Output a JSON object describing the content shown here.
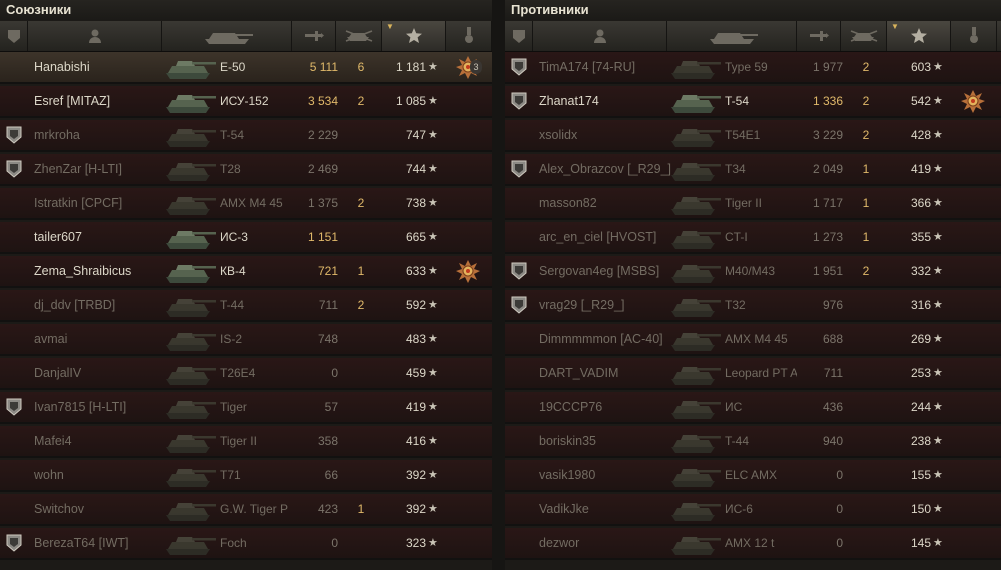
{
  "allies": {
    "title": "Союзники",
    "rows": [
      {
        "badge": false,
        "name": "Hanabishi",
        "tank": "E-50",
        "damage": "5 111",
        "kills": "6",
        "exp": "1 181",
        "medal": "order",
        "medal_count": "3",
        "alive": true,
        "self": true
      },
      {
        "badge": false,
        "name": "Esref [MITAZ]",
        "tank": "ИСУ-152",
        "damage": "3 534",
        "kills": "2",
        "exp": "1 085",
        "medal": "",
        "medal_count": "",
        "alive": true,
        "self": false
      },
      {
        "badge": true,
        "name": "mrkroha",
        "tank": "T-54",
        "damage": "2 229",
        "kills": "",
        "exp": "747",
        "medal": "",
        "medal_count": "",
        "alive": false,
        "self": false
      },
      {
        "badge": true,
        "name": "ZhenZar [H-LTI]",
        "tank": "T28",
        "damage": "2 469",
        "kills": "",
        "exp": "744",
        "medal": "",
        "medal_count": "",
        "alive": false,
        "self": false
      },
      {
        "badge": false,
        "name": "Istratkin [CPCF]",
        "tank": "AMX M4 45",
        "damage": "1 375",
        "kills": "2",
        "exp": "738",
        "medal": "",
        "medal_count": "",
        "alive": false,
        "self": false
      },
      {
        "badge": false,
        "name": "tailer607",
        "tank": "ИС-3",
        "damage": "1 151",
        "kills": "",
        "exp": "665",
        "medal": "",
        "medal_count": "",
        "alive": true,
        "self": false
      },
      {
        "badge": false,
        "name": "Zema_Shraibicus",
        "tank": "КВ-4",
        "damage": "721",
        "kills": "1",
        "exp": "633",
        "medal": "order",
        "medal_count": "",
        "alive": true,
        "self": false
      },
      {
        "badge": false,
        "name": "dj_ddv [TRBD]",
        "tank": "T-44",
        "damage": "711",
        "kills": "2",
        "exp": "592",
        "medal": "",
        "medal_count": "",
        "alive": false,
        "self": false
      },
      {
        "badge": false,
        "name": "avmai",
        "tank": "IS-2",
        "damage": "748",
        "kills": "",
        "exp": "483",
        "medal": "",
        "medal_count": "",
        "alive": false,
        "self": false
      },
      {
        "badge": false,
        "name": "DanjalIV",
        "tank": "T26E4",
        "damage": "0",
        "kills": "",
        "exp": "459",
        "medal": "",
        "medal_count": "",
        "alive": false,
        "self": false
      },
      {
        "badge": true,
        "name": "Ivan7815 [H-LTI]",
        "tank": "Tiger",
        "damage": "57",
        "kills": "",
        "exp": "419",
        "medal": "",
        "medal_count": "",
        "alive": false,
        "self": false
      },
      {
        "badge": false,
        "name": "Mafei4",
        "tank": "Tiger II",
        "damage": "358",
        "kills": "",
        "exp": "416",
        "medal": "",
        "medal_count": "",
        "alive": false,
        "self": false
      },
      {
        "badge": false,
        "name": "wohn",
        "tank": "T71",
        "damage": "66",
        "kills": "",
        "exp": "392",
        "medal": "",
        "medal_count": "",
        "alive": false,
        "self": false
      },
      {
        "badge": false,
        "name": "Switchov",
        "tank": "G.W. Tiger P",
        "damage": "423",
        "kills": "1",
        "exp": "392",
        "medal": "",
        "medal_count": "",
        "alive": false,
        "self": false
      },
      {
        "badge": true,
        "name": "BerezaT64 [IWT]",
        "tank": "Foch",
        "damage": "0",
        "kills": "",
        "exp": "323",
        "medal": "",
        "medal_count": "",
        "alive": false,
        "self": false
      }
    ]
  },
  "enemies": {
    "title": "Противники",
    "rows": [
      {
        "badge": true,
        "name": "TimA174 [74-RU]",
        "tank": "Type 59",
        "damage": "1 977",
        "kills": "2",
        "exp": "603",
        "medal": "",
        "medal_count": "",
        "alive": false,
        "self": false
      },
      {
        "badge": true,
        "name": "Zhanat174",
        "tank": "T-54",
        "damage": "1 336",
        "kills": "2",
        "exp": "542",
        "medal": "order",
        "medal_count": "",
        "alive": true,
        "self": false
      },
      {
        "badge": false,
        "name": "xsolidx",
        "tank": "T54E1",
        "damage": "3 229",
        "kills": "2",
        "exp": "428",
        "medal": "",
        "medal_count": "",
        "alive": false,
        "self": false
      },
      {
        "badge": true,
        "name": "Alex_Obrazcov [_R29_]",
        "tank": "T34",
        "damage": "2 049",
        "kills": "1",
        "exp": "419",
        "medal": "",
        "medal_count": "",
        "alive": false,
        "self": false
      },
      {
        "badge": false,
        "name": "masson82",
        "tank": "Tiger II",
        "damage": "1 717",
        "kills": "1",
        "exp": "366",
        "medal": "",
        "medal_count": "",
        "alive": false,
        "self": false
      },
      {
        "badge": false,
        "name": "arc_en_ciel [HVOST]",
        "tank": "CT-I",
        "damage": "1 273",
        "kills": "1",
        "exp": "355",
        "medal": "",
        "medal_count": "",
        "alive": false,
        "self": false
      },
      {
        "badge": true,
        "name": "Sergovan4eg [MSBS]",
        "tank": "M40/M43",
        "damage": "1 951",
        "kills": "2",
        "exp": "332",
        "medal": "",
        "medal_count": "",
        "alive": false,
        "self": false
      },
      {
        "badge": true,
        "name": "vrag29 [_R29_]",
        "tank": "T32",
        "damage": "976",
        "kills": "",
        "exp": "316",
        "medal": "",
        "medal_count": "",
        "alive": false,
        "self": false
      },
      {
        "badge": false,
        "name": "Dimmmmmon [AC-40]",
        "tank": "AMX M4 45",
        "damage": "688",
        "kills": "",
        "exp": "269",
        "medal": "",
        "medal_count": "",
        "alive": false,
        "self": false
      },
      {
        "badge": false,
        "name": "DART_VADIM",
        "tank": "Leopard PT A",
        "damage": "711",
        "kills": "",
        "exp": "253",
        "medal": "",
        "medal_count": "",
        "alive": false,
        "self": false
      },
      {
        "badge": false,
        "name": "19CCCP76",
        "tank": "ИС",
        "damage": "436",
        "kills": "",
        "exp": "244",
        "medal": "",
        "medal_count": "",
        "alive": false,
        "self": false
      },
      {
        "badge": false,
        "name": "boriskin35",
        "tank": "T-44",
        "damage": "940",
        "kills": "",
        "exp": "238",
        "medal": "",
        "medal_count": "",
        "alive": false,
        "self": false
      },
      {
        "badge": false,
        "name": "vasik1980",
        "tank": "ELC AMX",
        "damage": "0",
        "kills": "",
        "exp": "155",
        "medal": "",
        "medal_count": "",
        "alive": false,
        "self": false
      },
      {
        "badge": false,
        "name": "VadikJke",
        "tank": "ИС-6",
        "damage": "0",
        "kills": "",
        "exp": "150",
        "medal": "",
        "medal_count": "",
        "alive": false,
        "self": false
      },
      {
        "badge": false,
        "name": "dezwor",
        "tank": "AMX 12 t",
        "damage": "0",
        "kills": "",
        "exp": "145",
        "medal": "",
        "medal_count": "",
        "alive": false,
        "self": false
      }
    ]
  },
  "header_icons": [
    "squad-icon",
    "player-icon",
    "tank-icon",
    "damage-icon",
    "frags-icon",
    "experience-star-icon",
    "medal-icon"
  ],
  "star_glyph": "★",
  "colors": {
    "alive_text": "#dcd7c8",
    "dead_text": "#736c62",
    "damage_gold": "#e0b96a",
    "row_dead": "#2a1716"
  }
}
